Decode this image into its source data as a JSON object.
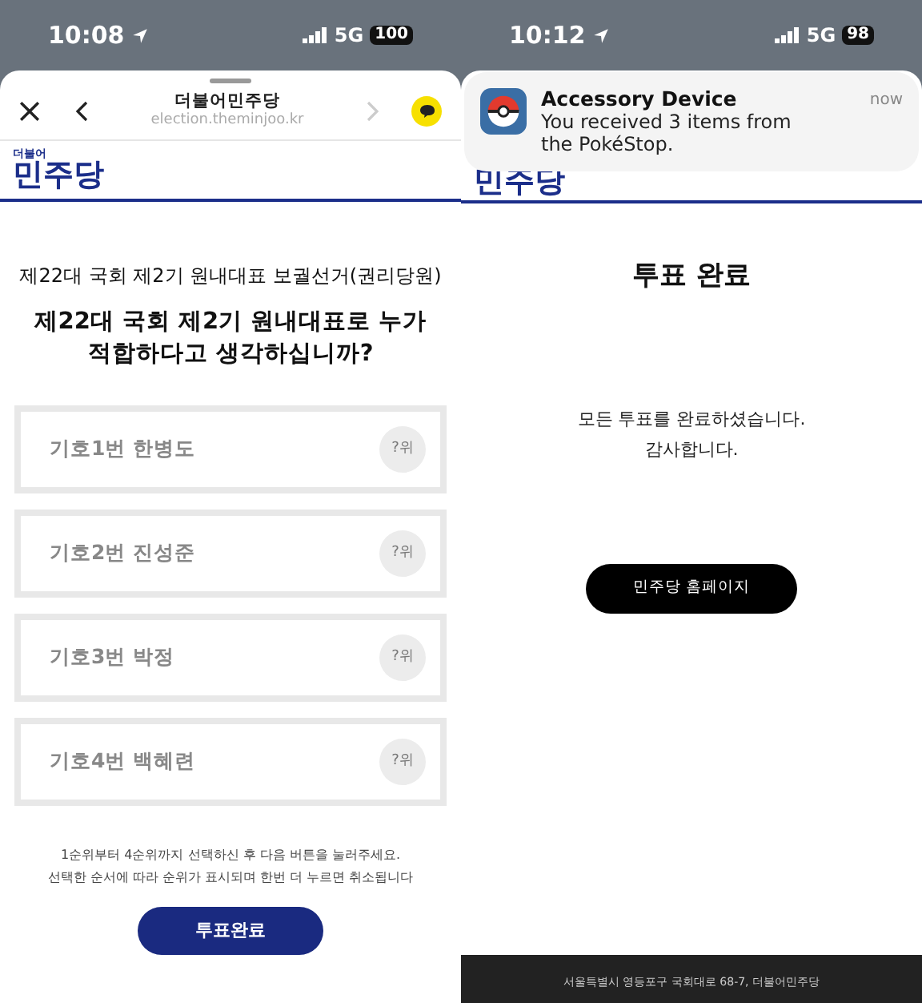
{
  "left_screen": {
    "status_bar": {
      "time": "10:08",
      "network": "5G",
      "battery": "100"
    },
    "browser": {
      "site_title": "더불어민주당",
      "url": "election.theminjoo.kr"
    },
    "logo": {
      "small": "더불어",
      "large": "민주당"
    },
    "election_title": "제22대 국회 제2기 원내대표 보궐선거(권리당원)",
    "question": "제22대 국회 제2기 원내대표로 누가\n적합하다고 생각하십니까?",
    "candidates": [
      {
        "label": "기호1번 한병도",
        "rank": "?위"
      },
      {
        "label": "기호2번 진성준",
        "rank": "?위"
      },
      {
        "label": "기호3번 박정",
        "rank": "?위"
      },
      {
        "label": "기호4번 백혜련",
        "rank": "?위"
      }
    ],
    "instructions": "1순위부터 4순위까지 선택하신 후 다음 버튼을 눌러주세요.\n선택한 순서에 따라 순위가 표시되며 한번 더 누르면 취소됩니다",
    "submit_button": "투표완료"
  },
  "right_screen": {
    "status_bar": {
      "time": "10:12",
      "network": "5G",
      "battery": "98"
    },
    "notification": {
      "title": "Accessory Device",
      "body": "You received 3 items from\nthe PokéStop.",
      "time": "now"
    },
    "logo": {
      "large": "민주당"
    },
    "heading": "투표 완료",
    "message": "모든 투표를 완료하셨습니다.\n감사합니다.",
    "home_button": "민주당 홈페이지",
    "footer": {
      "address": "서울특별시 영등포구 국회대로 68-7, 더불어민주당"
    }
  }
}
